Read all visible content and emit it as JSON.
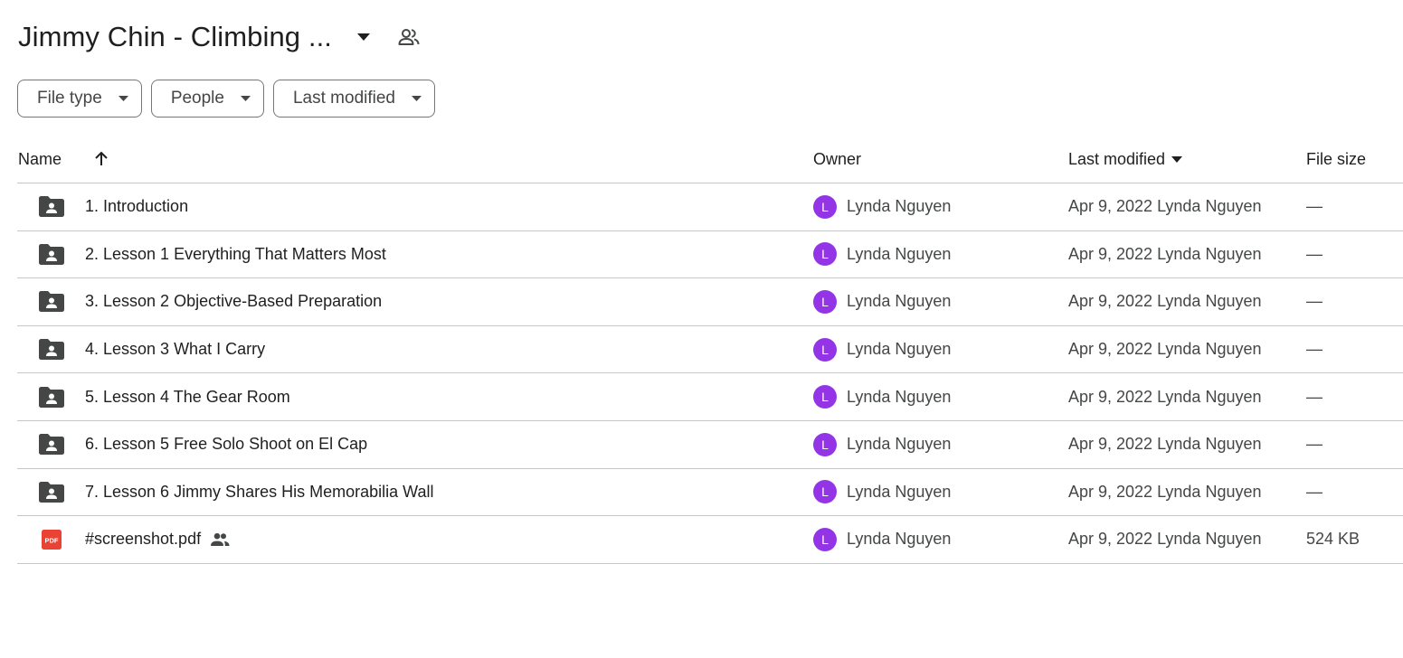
{
  "header": {
    "title": "Jimmy Chin - Climbing ..."
  },
  "filters": [
    {
      "label": "File type"
    },
    {
      "label": "People"
    },
    {
      "label": "Last modified"
    }
  ],
  "table": {
    "columns": {
      "name": "Name",
      "owner": "Owner",
      "last_modified": "Last modified",
      "file_size": "File size"
    },
    "rows": [
      {
        "type": "shared-folder",
        "name": "1. Introduction",
        "owner_initial": "L",
        "owner": "Lynda Nguyen",
        "modified": "Apr 9, 2022 Lynda Nguyen",
        "size": "—"
      },
      {
        "type": "shared-folder",
        "name": "2. Lesson 1 Everything That Matters Most",
        "owner_initial": "L",
        "owner": "Lynda Nguyen",
        "modified": "Apr 9, 2022 Lynda Nguyen",
        "size": "—"
      },
      {
        "type": "shared-folder",
        "name": "3. Lesson 2 Objective-Based Preparation",
        "owner_initial": "L",
        "owner": "Lynda Nguyen",
        "modified": "Apr 9, 2022 Lynda Nguyen",
        "size": "—"
      },
      {
        "type": "shared-folder",
        "name": "4. Lesson 3 What I Carry",
        "owner_initial": "L",
        "owner": "Lynda Nguyen",
        "modified": "Apr 9, 2022 Lynda Nguyen",
        "size": "—"
      },
      {
        "type": "shared-folder",
        "name": "5. Lesson 4 The Gear Room",
        "owner_initial": "L",
        "owner": "Lynda Nguyen",
        "modified": "Apr 9, 2022 Lynda Nguyen",
        "size": "—"
      },
      {
        "type": "shared-folder",
        "name": "6. Lesson 5 Free Solo Shoot on El Cap",
        "owner_initial": "L",
        "owner": "Lynda Nguyen",
        "modified": "Apr 9, 2022 Lynda Nguyen",
        "size": "—"
      },
      {
        "type": "shared-folder",
        "name": "7. Lesson 6 Jimmy Shares His Memorabilia Wall",
        "owner_initial": "L",
        "owner": "Lynda Nguyen",
        "modified": "Apr 9, 2022 Lynda Nguyen",
        "size": "—"
      },
      {
        "type": "pdf",
        "name": "#screenshot.pdf",
        "shared": true,
        "owner_initial": "L",
        "owner": "Lynda Nguyen",
        "modified": "Apr 9, 2022 Lynda Nguyen",
        "size": "524 KB"
      }
    ]
  },
  "icons": {
    "folder": "shared-folder-icon",
    "pdf": "pdf-file-icon",
    "shared": "people-icon"
  },
  "pdf_badge": "PDF",
  "colors": {
    "avatar": "#9334e6",
    "pdf": "#ea4335",
    "folder": "#444746",
    "divider": "#c7c7c7"
  }
}
